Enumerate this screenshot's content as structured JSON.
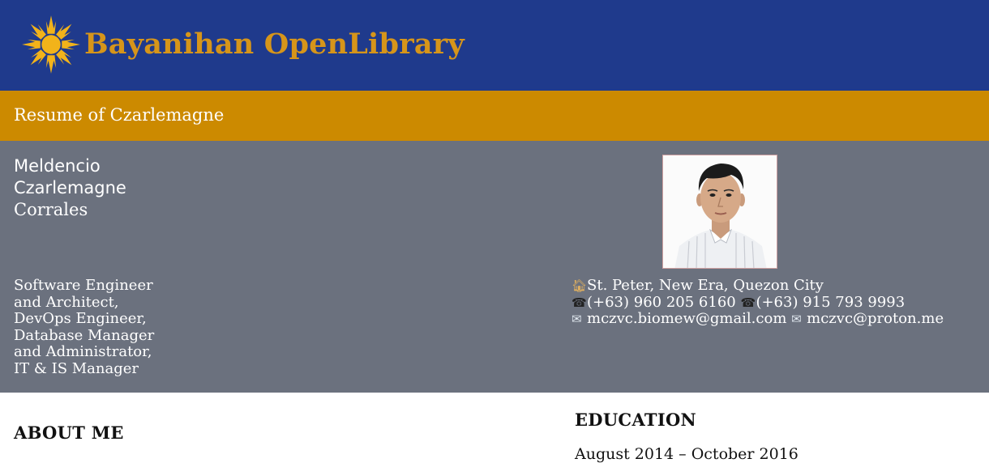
{
  "header": {
    "brand": "Bayanihan OpenLibrary",
    "logo_icon": "sun-logo-icon",
    "bg_color": "#1f3a8c",
    "brand_color": "#d6951a"
  },
  "title_bar": {
    "title": "Resume of Czarlemagne",
    "bg_color": "#cc8a00"
  },
  "profile": {
    "bg_color": "#6b717e",
    "name": {
      "first": "Meldencio",
      "middle": "Czarlemagne",
      "last": "Corrales"
    },
    "photo_icon": "profile-photo",
    "roles": [
      "Software Engineer",
      "and Architect,",
      "DevOps Engineer,",
      "Database Manager",
      "and Administrator,",
      "IT & IS Manager"
    ],
    "contacts": {
      "address_icon": "house-icon",
      "address": "St. Peter, New Era, Quezon City",
      "phone_icon": "phone-icon",
      "phone_1": "(+63) 960 205 6160",
      "phone_2": "(+63) 915 793 9993",
      "email_icon": "envelope-icon",
      "email_1": "mczvc.biomew@gmail.com",
      "email_2": "mczvc@proton.me"
    }
  },
  "sections": {
    "about_title": "ABOUT ME",
    "education_title": "EDUCATION",
    "education_first_date": "August 2014 – October 2016"
  }
}
